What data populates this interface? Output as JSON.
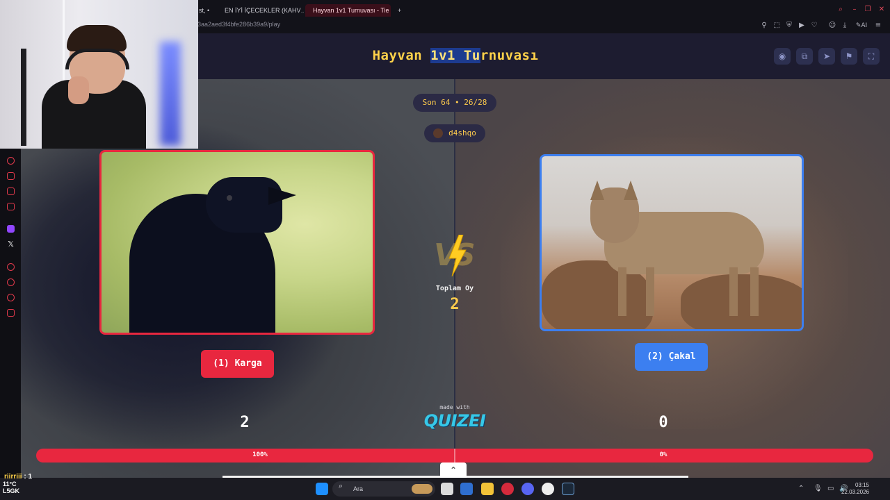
{
  "browser": {
    "tabs": [
      {
        "label": "st, •",
        "active": false
      },
      {
        "label": "EN İYİ İÇECEKLER (KAHV…",
        "active": false
      },
      {
        "label": "Hayvan 1v1 Turnuvası - Tie",
        "active": true
      }
    ],
    "new_tab": "+",
    "url": "3aa2aed3f4bfe286b39a9/play"
  },
  "quiz": {
    "title_pre": "Hayvan ",
    "title_sel": "1v1 Tu",
    "title_post": "rnuvası",
    "round_pill": "Son 64 • 26/28",
    "username": "d4shqo",
    "left": {
      "name": "(1) Karga",
      "score": "2",
      "percent": "100%"
    },
    "right": {
      "name": "(2) Çakal",
      "score": "0",
      "percent": "0%"
    },
    "vs": "VS",
    "total_label": "Toplam Oy",
    "total_value": "2",
    "made_with": "made with",
    "brand": "QUIZEI",
    "left_share": 1.0,
    "colors": {
      "left": "#e8273f",
      "right": "#3c7ff0",
      "accent": "#ffcc4d"
    }
  },
  "taskbar": {
    "search_placeholder": "Ara",
    "weather_temp": "11°C",
    "weather_ticker": "L5GK",
    "time": "03:15",
    "date": "22.03.2026"
  },
  "overlay": {
    "chat_user": "riirriii",
    "chat_value": ": 1"
  }
}
